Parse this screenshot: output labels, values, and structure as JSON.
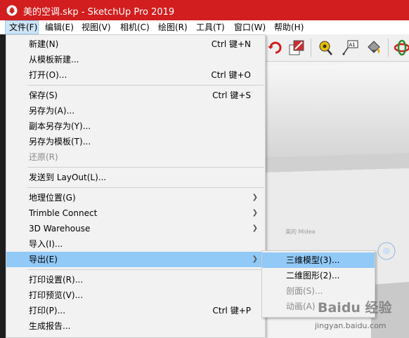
{
  "window": {
    "title": "美的空调.skp - SketchUp Pro 2019"
  },
  "menubar": [
    {
      "label": "文件(F)",
      "active": true
    },
    {
      "label": "编辑(E)"
    },
    {
      "label": "视图(V)"
    },
    {
      "label": "相机(C)"
    },
    {
      "label": "绘图(R)"
    },
    {
      "label": "工具(T)"
    },
    {
      "label": "窗口(W)"
    },
    {
      "label": "帮助(H)"
    }
  ],
  "toolbar": {
    "icons": [
      "rotate-icon",
      "scale-icon",
      "tape-measure-icon",
      "text-label-icon",
      "paint-bucket-icon",
      "orbit-icon"
    ],
    "text_tool_label": "A1"
  },
  "file_menu": {
    "items": [
      {
        "label": "新建(N)",
        "shortcut": "Ctrl 键+N"
      },
      {
        "label": "从模板新建..."
      },
      {
        "label": "打开(O)...",
        "shortcut": "Ctrl 键+O"
      },
      {
        "label": "保存(S)",
        "shortcut": "Ctrl 键+S"
      },
      {
        "label": "另存为(A)..."
      },
      {
        "label": "副本另存为(Y)..."
      },
      {
        "label": "另存为模板(T)..."
      },
      {
        "label": "还原(R)",
        "disabled": true
      },
      {
        "label": "发送到 LayOut(L)..."
      },
      {
        "label": "地理位置(G)",
        "submenu": true
      },
      {
        "label": "Trimble Connect",
        "submenu": true
      },
      {
        "label": "3D Warehouse",
        "submenu": true
      },
      {
        "label": "导入(I)..."
      },
      {
        "label": "导出(E)",
        "submenu": true,
        "highlighted": true
      },
      {
        "label": "打印设置(R)..."
      },
      {
        "label": "打印预览(V)..."
      },
      {
        "label": "打印(P)...",
        "shortcut": "Ctrl 键+P"
      },
      {
        "label": "生成报告..."
      }
    ]
  },
  "export_submenu": {
    "items": [
      {
        "label": "三维模型(3)...",
        "highlighted": true
      },
      {
        "label": "二维图形(2)..."
      },
      {
        "label": "剖面(S)...",
        "disabled": true
      },
      {
        "label": "动画(A)",
        "disabled": true
      }
    ]
  },
  "viewport": {
    "brand_text": "美的 Midea"
  },
  "watermark": {
    "logo_text": "Baidu 经验",
    "url": "jingyan.baidu.com"
  },
  "colors": {
    "titlebar": "#d21e1e",
    "highlight": "#91c9f7",
    "menu_bg": "#f2f2f2"
  }
}
